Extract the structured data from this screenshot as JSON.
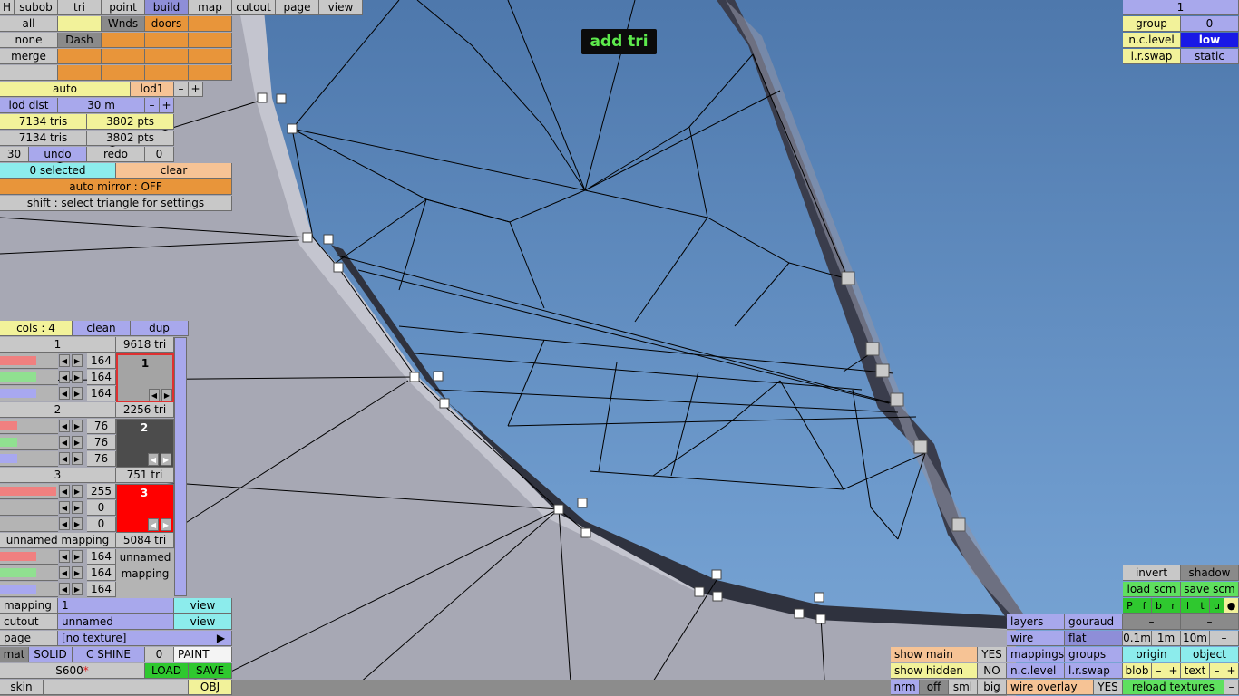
{
  "tooltip": "add tri",
  "menu": {
    "h": "H",
    "tabs": [
      "subob",
      "tri",
      "point",
      "build",
      "map",
      "cutout",
      "page",
      "view"
    ]
  },
  "sel": {
    "all": "all",
    "wnds": "Wnds",
    "doors": "doors",
    "none": "none",
    "dash": "Dash",
    "merge": "merge",
    "minus": "–"
  },
  "lod": {
    "auto": "auto",
    "lod1": "lod1",
    "minus": "–",
    "plus": "+",
    "dist_label": "lod dist",
    "dist_value": "30 m",
    "tris1": "7134 tris",
    "pts1": "3802 pts",
    "tris2": "7134 tris",
    "pts2": "3802 pts"
  },
  "history": {
    "count": "30",
    "undo": "undo",
    "redo": "redo",
    "redo_count": "0"
  },
  "selection": {
    "status": "0 selected",
    "clear": "clear",
    "mirror": "auto mirror : OFF",
    "hint": "shift : select triangle for settings"
  },
  "colors": {
    "cols": "cols : 4",
    "clean": "clean",
    "dup": "dup",
    "items": [
      {
        "name": "1",
        "tris": "9618 tri",
        "r": "164",
        "g": "164",
        "b": "164",
        "swatch_label": "1",
        "swatch_color": "#a4a4a4",
        "text_color": "#000000",
        "rf": 0.64,
        "gf": 0.64,
        "bf": 0.64
      },
      {
        "name": "2",
        "tris": "2256 tri",
        "r": "76",
        "g": "76",
        "b": "76",
        "swatch_label": "2",
        "swatch_color": "#4c4c4c",
        "text_color": "#ffffff",
        "rf": 0.3,
        "gf": 0.3,
        "bf": 0.3
      },
      {
        "name": "3",
        "tris": "751 tri",
        "r": "255",
        "g": "0",
        "b": "0",
        "swatch_label": "3",
        "swatch_color": "#ff0000",
        "text_color": "#ffffff",
        "rf": 1.0,
        "gf": 0.0,
        "bf": 0.0
      }
    ],
    "mapping": {
      "name": "unnamed mapping",
      "tris": "5084 tri",
      "r": "164",
      "g": "164",
      "b": "164",
      "label1": "unnamed",
      "label2": "mapping"
    }
  },
  "props": {
    "mapping_label": "mapping",
    "mapping_value": "1",
    "view": "view",
    "cutout_label": "cutout",
    "cutout_value": "unnamed",
    "page_label": "page",
    "page_value": "[no texture]",
    "mat": "mat",
    "solid": "SOLID",
    "cshine": "C SHINE",
    "zero": "0",
    "paint": "PAINT",
    "file": "S600",
    "modified": "*",
    "load": "LOAD",
    "save": "SAVE",
    "skin": "skin",
    "obj": "OBJ"
  },
  "topright": {
    "one": "1",
    "group": "group",
    "group_val": "0",
    "nclevel": "n.c.level",
    "nclevel_val": "low",
    "lrswap": "l.r.swap",
    "lrswap_val": "static"
  },
  "bottomright": {
    "show_main": "show main",
    "show_main_val": "YES",
    "show_hidden": "show hidden",
    "show_hidden_val": "NO",
    "nrm": "nrm",
    "off": "off",
    "sml": "sml",
    "big": "big",
    "layers": "layers",
    "gouraud": "gouraud",
    "wire": "wire",
    "flat": "flat",
    "mappings": "mappings",
    "groups": "groups",
    "nclevel": "n.c.level",
    "lrswap": "l.r.swap",
    "wire_overlay": "wire overlay",
    "wire_overlay_val": "YES",
    "invert": "invert",
    "shadow": "shadow",
    "load_scm": "load scm",
    "save_scm": "save scm",
    "letters": [
      "P",
      "f",
      "b",
      "r",
      "l",
      "t",
      "u",
      "●"
    ],
    "dash1": "–",
    "dash2": "–",
    "d01": "0.1m",
    "d1": "1m",
    "d10": "10m",
    "dminus": "–",
    "origin": "origin",
    "object": "object",
    "blob": "blob",
    "text": "text",
    "minus": "–",
    "plus": "+",
    "reload": "reload textures"
  }
}
